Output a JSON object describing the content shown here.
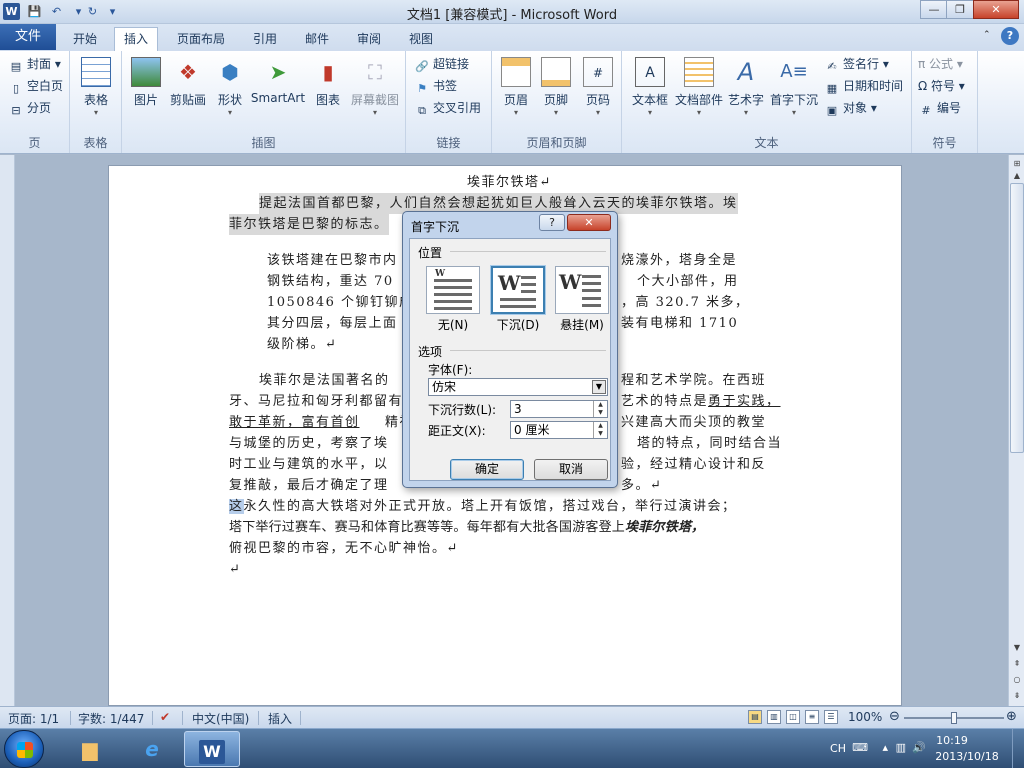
{
  "window": {
    "title": "文档1 [兼容模式] - Microsoft Word",
    "logo": "W",
    "minimize": "—",
    "maximize": "❐",
    "close": "✕"
  },
  "qat": {
    "save": "💾",
    "undo": "↶",
    "redo": "↻",
    "customize": "▾"
  },
  "tabs": {
    "file": "文件",
    "items": [
      "开始",
      "插入",
      "页面布局",
      "引用",
      "邮件",
      "审阅",
      "视图"
    ],
    "active": "插入"
  },
  "ribbon": {
    "pages": {
      "label": "页",
      "cover": "封面 ▾",
      "blank": "空白页",
      "break": "分页"
    },
    "tables": {
      "label": "表格",
      "table": "表格"
    },
    "illustrations": {
      "label": "插图",
      "items": [
        "图片",
        "剪贴画",
        "形状",
        "SmartArt",
        "图表",
        "屏幕截图"
      ]
    },
    "links": {
      "label": "链接",
      "hyperlink": "超链接",
      "bookmark": "书签",
      "crossref": "交叉引用"
    },
    "header_footer": {
      "label": "页眉和页脚",
      "header": "页眉",
      "footer": "页脚",
      "page_number": "页码"
    },
    "text": {
      "label": "文本",
      "textbox": "文本框",
      "quickparts": "文档部件",
      "wordart": "艺术字",
      "dropcap": "首字下沉",
      "signature": "签名行 ▾",
      "datetime": "日期和时间",
      "object": "对象 ▾"
    },
    "symbols": {
      "label": "符号",
      "equation": "π 公式 ▾",
      "symbol": "Ω 符号 ▾",
      "number": "编号"
    }
  },
  "document": {
    "title": "埃菲尔铁塔↵",
    "p1_line1": "提起法国首都巴黎，人们自然会想起犹如巨人般耸入云天的埃菲尔铁塔。埃",
    "p1_line2": "菲尔铁塔是巴黎的标志。",
    "p2": [
      "该铁塔建在巴黎市内",
      "烧濠外，塔身全是",
      "钢铁结构，重达 70",
      "个大小部件，用",
      "1050846 个铆钉铆成",
      "，高 320.7 米多，",
      "其分四层，每层上面",
      "装有电梯和 1710",
      "级阶梯。↵"
    ],
    "p3": [
      [
        "埃菲尔是法国著名的",
        "程和艺术学院。在西班"
      ],
      [
        "牙、马尼拉和匈牙利都留有",
        "艺术的特点是"
      ],
      [
        "敢于革新，富有首创",
        "精神",
        "兴建高大而尖顶的教堂"
      ],
      [
        "与城堡的历史，考察了埃",
        "塔的特点，同时结合当"
      ],
      [
        "时工业与建筑的水平，以",
        "验，经过精心设计和反"
      ],
      [
        "复推敲，最后才确定了理",
        "多。↵"
      ]
    ],
    "p3_underline": "勇于实践，",
    "p4_line1_hl": "这",
    "p4_line1": "永久性的高大铁塔对外正式开放。塔上开有饭馆，搭过戏台，举行过演讲会；",
    "p4_line2a": "塔下举行过赛车、赛马和体育比赛等等。每年都有大批各国游客登上",
    "p4_line2b": "埃菲尔铁塔，",
    "p4_line3": "俯视巴黎的市容，无不心旷神怡。↵",
    "p5": "↵"
  },
  "dialog": {
    "title": "首字下沉",
    "help": "?",
    "close": "✕",
    "position_label": "位置",
    "options": [
      {
        "label": "无(N)",
        "selected": false
      },
      {
        "label": "下沉(D)",
        "selected": true
      },
      {
        "label": "悬挂(M)",
        "selected": false
      }
    ],
    "options_label": "选项",
    "font_label": "字体(F):",
    "font_value": "仿宋",
    "lines_label": "下沉行数(L):",
    "lines_value": "3",
    "distance_label": "距正文(X):",
    "distance_value": "0 厘米",
    "ok": "确定",
    "cancel": "取消"
  },
  "status": {
    "page": "页面: 1/1",
    "words": "字数: 1/447",
    "language": "中文(中国)",
    "mode": "插入",
    "zoom": "100%",
    "zoom_level": 100
  },
  "taskbar": {
    "ime": "CH",
    "time": "10:19",
    "date": "2013/10/18"
  },
  "colors": {
    "accent": "#2b579a",
    "ribbon_bg": "#e5edf8",
    "dialog_bg": "#c2d4ec"
  }
}
